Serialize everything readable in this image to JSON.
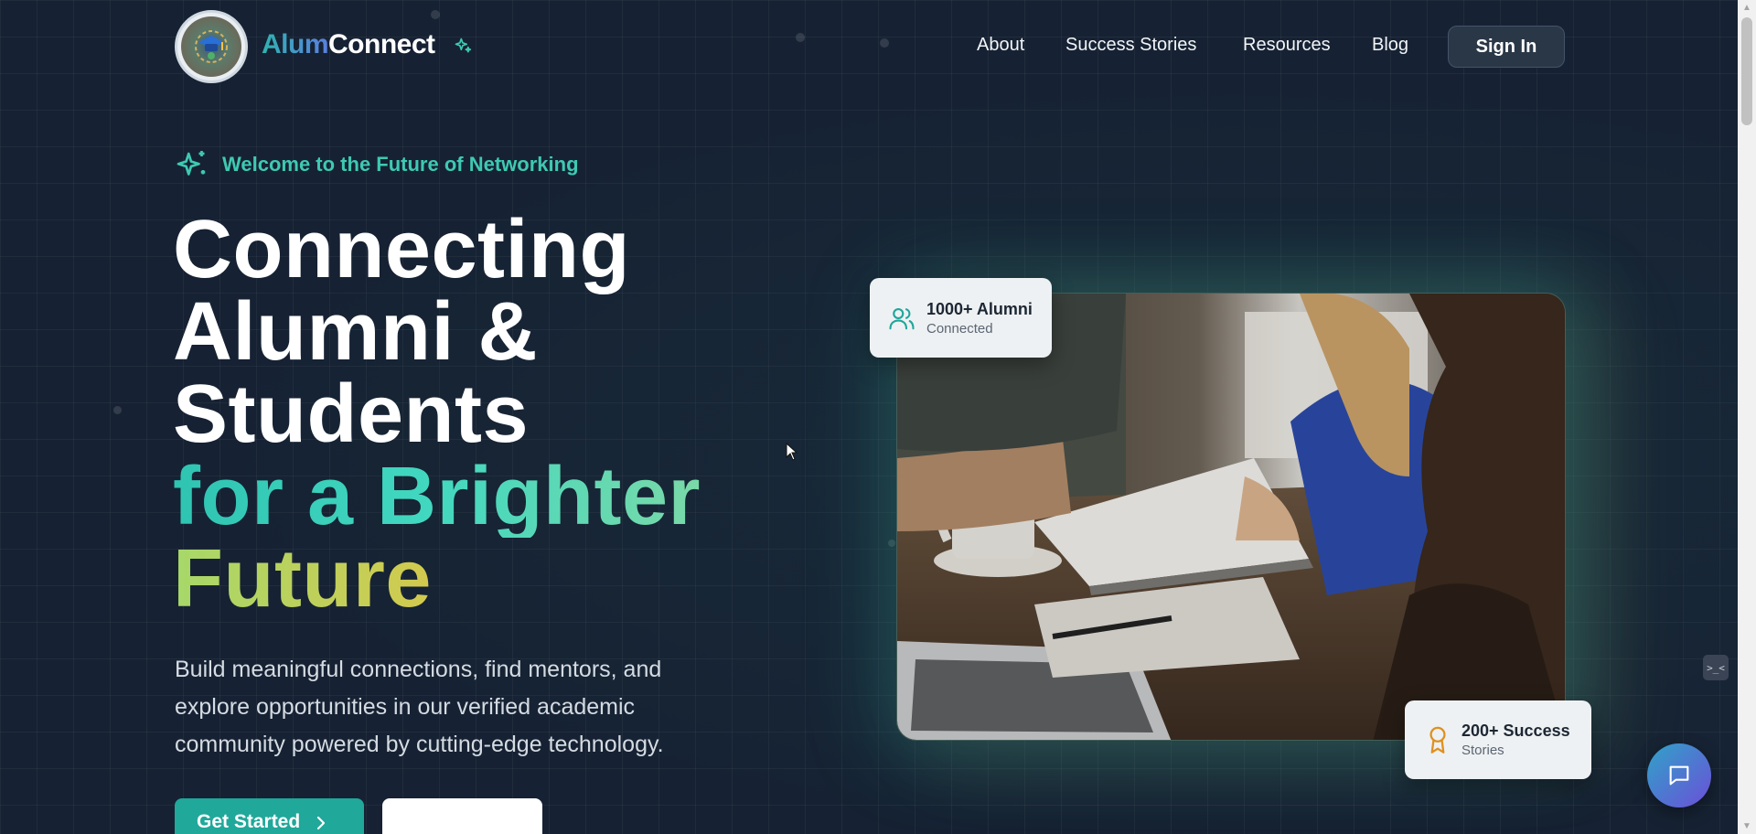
{
  "brand": {
    "name_part1": "Alum",
    "name_part2": "Connect",
    "logo_icon": "graduation-gears-logo",
    "sparkle_icon": "sparkle-icon"
  },
  "nav": {
    "links": [
      "About",
      "Success Stories",
      "Resources",
      "Blog"
    ],
    "signin_label": "Sign In"
  },
  "hero": {
    "eyebrow": "Welcome to the Future of Networking",
    "headline_lines": [
      "Connecting",
      "Alumni &",
      "Students"
    ],
    "headline_gradient_line1": "for a Brighter",
    "headline_gradient_line2": "Future",
    "subtext": "Build meaningful connections, find mentors, and explore opportunities in our verified academic community powered by cutting-edge technology.",
    "primary_button": "Get Started",
    "secondary_button": ""
  },
  "stats": {
    "alumni_title": "1000+ Alumni",
    "alumni_sub": "Connected",
    "stories_title": "200+ Success",
    "stories_sub": "Stories"
  },
  "photo": {
    "description_icon": "students-studying-photo"
  },
  "colors": {
    "accent_teal": "#20a89a",
    "background": "#162233",
    "gradient_yellow": "#f2b93a"
  }
}
